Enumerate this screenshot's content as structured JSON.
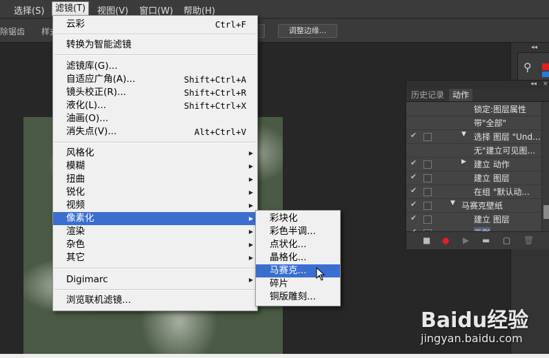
{
  "menubar": {
    "items": [
      "选择(S)",
      "滤镜(T)",
      "视图(V)",
      "窗口(W)",
      "帮助(H)"
    ]
  },
  "options_bar": {
    "antialias_label": "除锯齿",
    "style_label": "样式",
    "refine_edge_button": "调整边缘..."
  },
  "filter_menu": {
    "last_filter": {
      "label": "云彩",
      "shortcut": "Ctrl+F"
    },
    "convert_smart": "转换为智能滤镜",
    "gallery": {
      "label": "滤镜库(G)...",
      "shortcut": ""
    },
    "adaptive_wide": {
      "label": "自适应广角(A)...",
      "shortcut": "Shift+Ctrl+A"
    },
    "lens_correction": {
      "label": "镜头校正(R)...",
      "shortcut": "Shift+Ctrl+R"
    },
    "liquify": {
      "label": "液化(L)...",
      "shortcut": "Shift+Ctrl+X"
    },
    "oil_paint": {
      "label": "油画(O)...",
      "shortcut": ""
    },
    "vanishing_point": {
      "label": "消失点(V)...",
      "shortcut": "Alt+Ctrl+V"
    },
    "stylize": "风格化",
    "blur": "模糊",
    "distort": "扭曲",
    "sharpen": "锐化",
    "video": "视频",
    "pixelate": "像素化",
    "render": "渲染",
    "noise": "杂色",
    "other": "其它",
    "digimarc": "Digimarc",
    "browse_online": "浏览联机滤镜..."
  },
  "pixelate_submenu": {
    "items": [
      "彩块化",
      "彩色半调...",
      "点状化...",
      "晶格化...",
      "马赛克...",
      "碎片",
      "铜版雕刻..."
    ],
    "highlighted": "马赛克..."
  },
  "actions_panel": {
    "tabs": [
      "历史记录",
      "动作"
    ],
    "active_tab": "动作",
    "rows": [
      {
        "text": "锁定:图层属性",
        "indent": "step-detail"
      },
      {
        "text": "带\"全部\"",
        "indent": "step-detail"
      },
      {
        "text": "选择 图层 \"Und...",
        "indent": "step",
        "expanded": true
      },
      {
        "text": "无\"建立可见图...",
        "indent": "step-detail"
      },
      {
        "text": "建立 动作",
        "indent": "step",
        "expanded": false
      },
      {
        "text": "建立 图层",
        "indent": "step"
      },
      {
        "text": "在组 \"默认动...",
        "indent": "step"
      },
      {
        "text": "马赛克壁纸",
        "indent": "action",
        "expanded": true
      },
      {
        "text": "建立 图层",
        "indent": "step"
      },
      {
        "text": "云彩",
        "indent": "step",
        "selected": true
      }
    ]
  },
  "watermark": {
    "brand": "Baidu经验",
    "url": "jingyan.baidu.com"
  },
  "colors": {
    "menu_highlight": "#3a6fd0",
    "menu_bg": "#f0f0f0",
    "record_red": "#e02020"
  }
}
